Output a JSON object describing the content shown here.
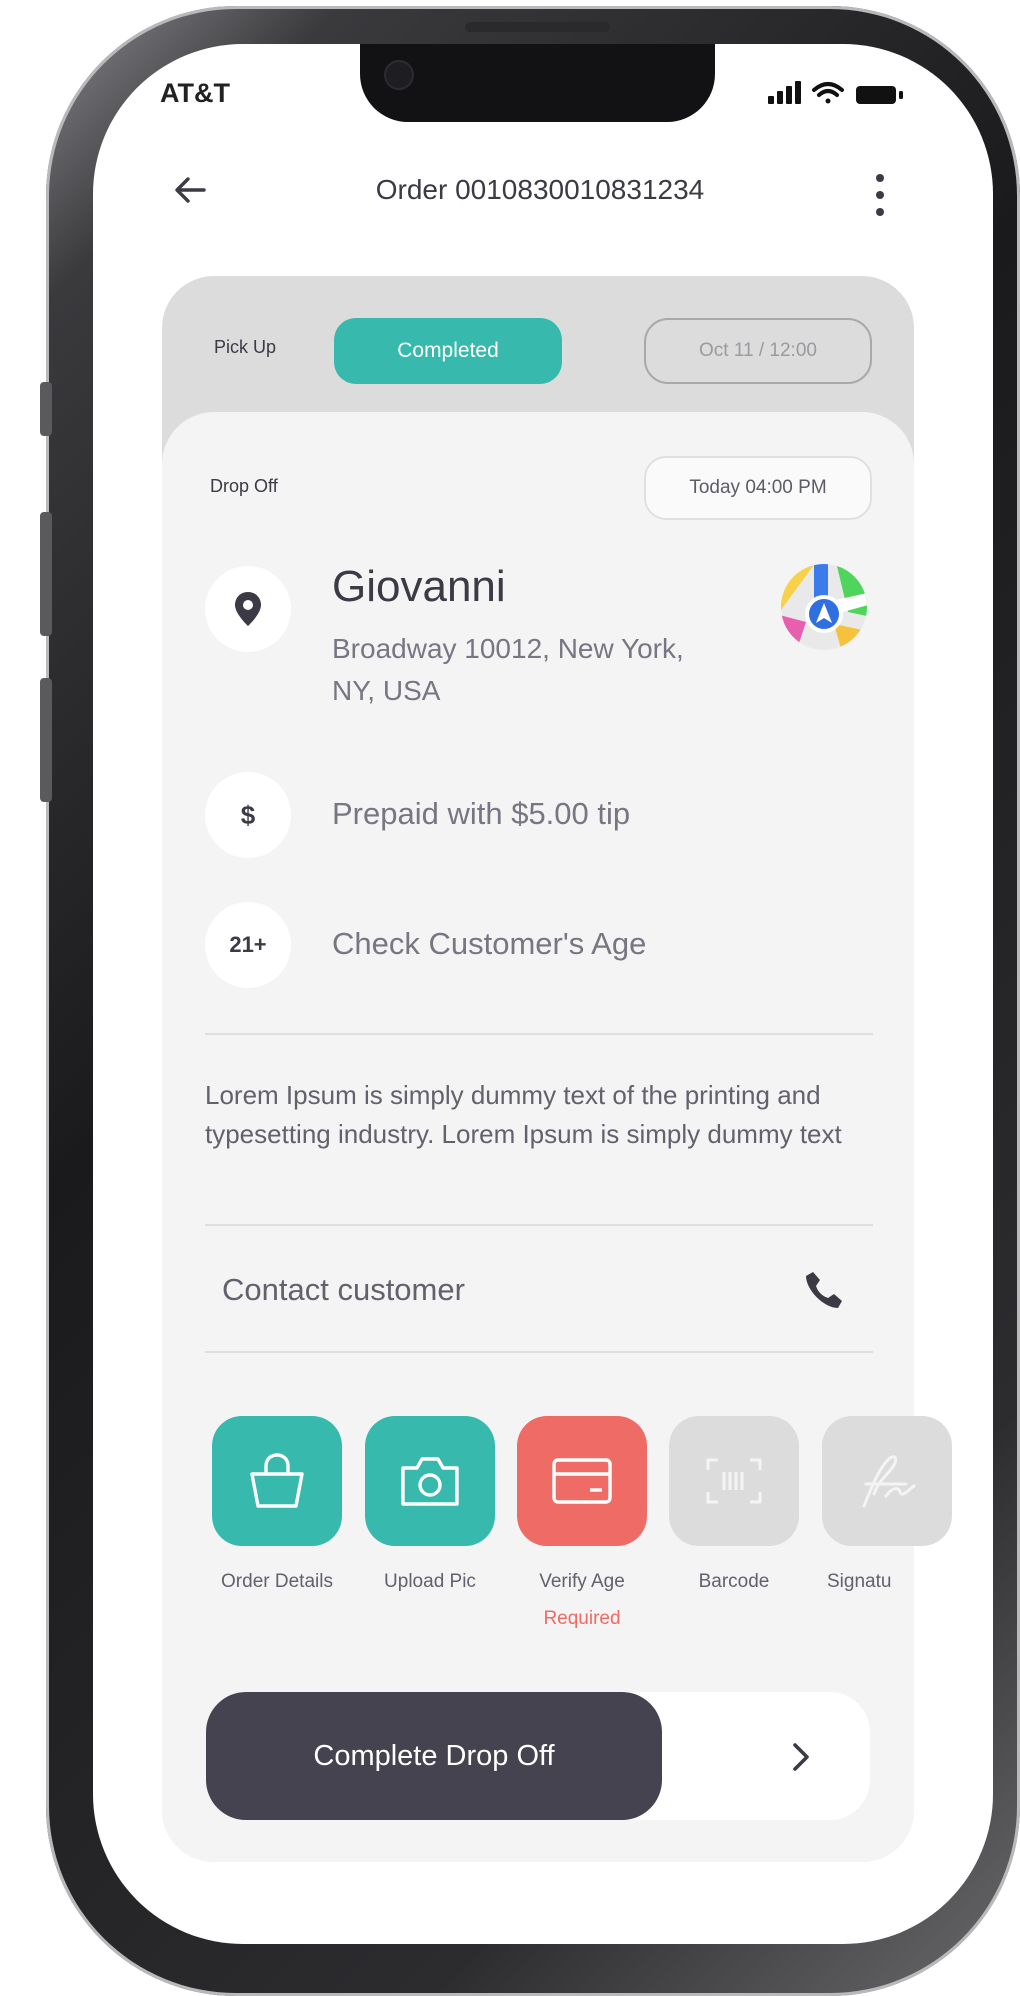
{
  "status_bar": {
    "carrier": "AT&T"
  },
  "header": {
    "title": "Order 0010830010831234"
  },
  "pickup": {
    "label": "Pick Up",
    "status": "Completed",
    "time": "Oct 11 / 12:00"
  },
  "dropoff": {
    "label": "Drop Off",
    "time": "Today 04:00 PM"
  },
  "customer": {
    "name": "Giovanni",
    "address": "Broadway 10012, New York, NY, USA"
  },
  "payment": {
    "icon_text": "$",
    "text": "Prepaid  with $5.00 tip"
  },
  "age_check": {
    "icon_text": "21+",
    "text": "Check Customer's Age"
  },
  "description": "Lorem Ipsum is simply dummy text of the printing and typesetting industry. Lorem Ipsum is simply dummy text",
  "contact": {
    "label": "Contact customer"
  },
  "actions": [
    {
      "label": "Order Details",
      "icon": "shopping-bag-icon",
      "color": "#37b9ad"
    },
    {
      "label": "Upload Pic",
      "icon": "camera-icon",
      "color": "#37b9ad"
    },
    {
      "label": "Verify Age",
      "icon": "id-card-icon",
      "color": "#ee6b66",
      "note": "Required"
    },
    {
      "label": "Barcode",
      "icon": "barcode-icon",
      "color": "#dcdcdc"
    },
    {
      "label": "Signatu",
      "icon": "signature-icon",
      "color": "#dcdcdc"
    }
  ],
  "complete_button": {
    "label": "Complete Drop  Off"
  },
  "colors": {
    "teal": "#37b9ad",
    "red": "#ee6b66",
    "dark": "#45434f",
    "card_bg": "#f4f4f4"
  }
}
